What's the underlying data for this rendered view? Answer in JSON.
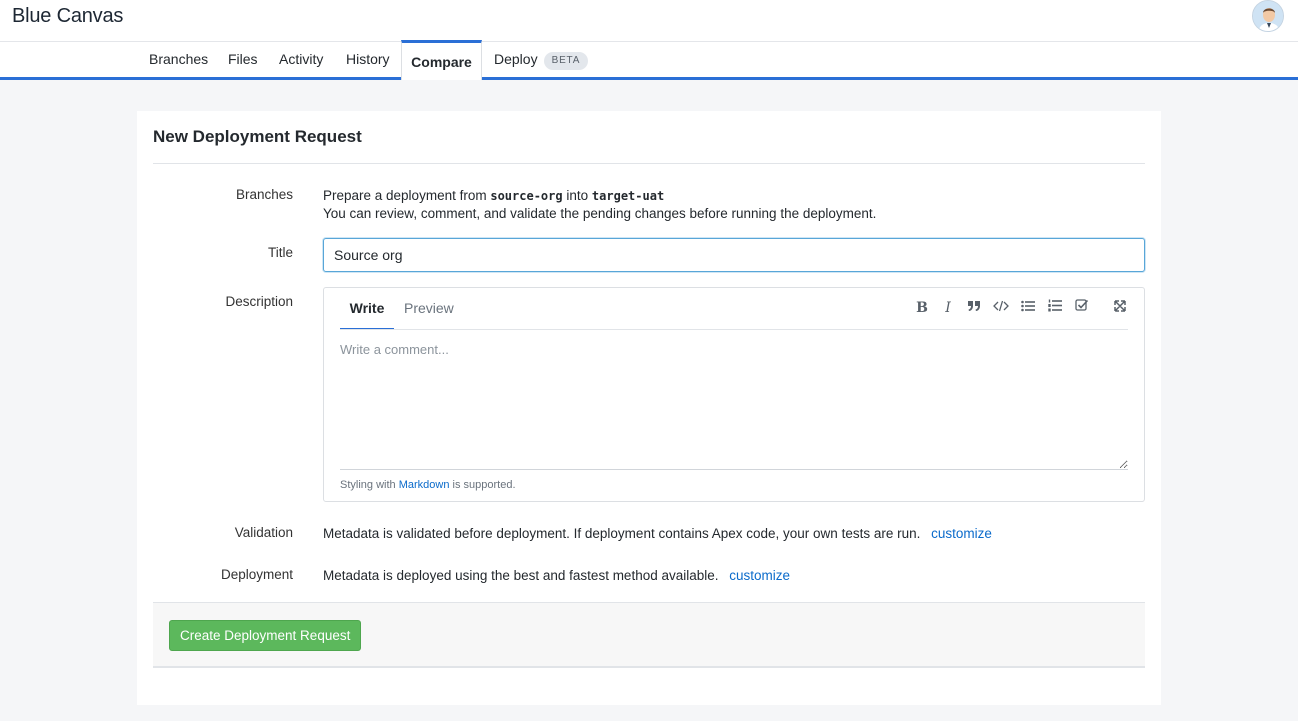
{
  "app": {
    "title": "Blue Canvas"
  },
  "nav": {
    "tabs": [
      {
        "label": "Branches"
      },
      {
        "label": "Files"
      },
      {
        "label": "Activity"
      },
      {
        "label": "History"
      },
      {
        "label": "Compare"
      },
      {
        "label": "Deploy",
        "badge": "BETA"
      }
    ],
    "active_tab": "Compare"
  },
  "form": {
    "heading": "New Deployment Request",
    "branches": {
      "label": "Branches",
      "prefix": "Prepare a deployment from",
      "source": "source-org",
      "joiner": "into",
      "target": "target-uat",
      "note": "You can review, comment, and validate the pending changes before running the deployment."
    },
    "title": {
      "label": "Title",
      "value": "Source org"
    },
    "description": {
      "label": "Description",
      "tabs": {
        "write": "Write",
        "preview": "Preview"
      },
      "placeholder": "Write a comment...",
      "footer_prefix": "Styling with",
      "footer_link": "Markdown",
      "footer_suffix": "is supported.",
      "toolbar": [
        "bold-icon",
        "italic-icon",
        "quote-icon",
        "code-icon",
        "bulleted-list-icon",
        "numbered-list-icon",
        "task-list-icon",
        "fullscreen-icon"
      ]
    },
    "validation": {
      "label": "Validation",
      "text": "Metadata is validated before deployment. If deployment contains Apex code, your own tests are run.",
      "link": "customize"
    },
    "deployment": {
      "label": "Deployment",
      "text": "Metadata is deployed using the best and fastest method available.",
      "link": "customize"
    },
    "submit_label": "Create Deployment Request"
  },
  "colors": {
    "accent": "#2a6fd6",
    "link": "#0b6bcb",
    "success": "#5cb85c"
  }
}
